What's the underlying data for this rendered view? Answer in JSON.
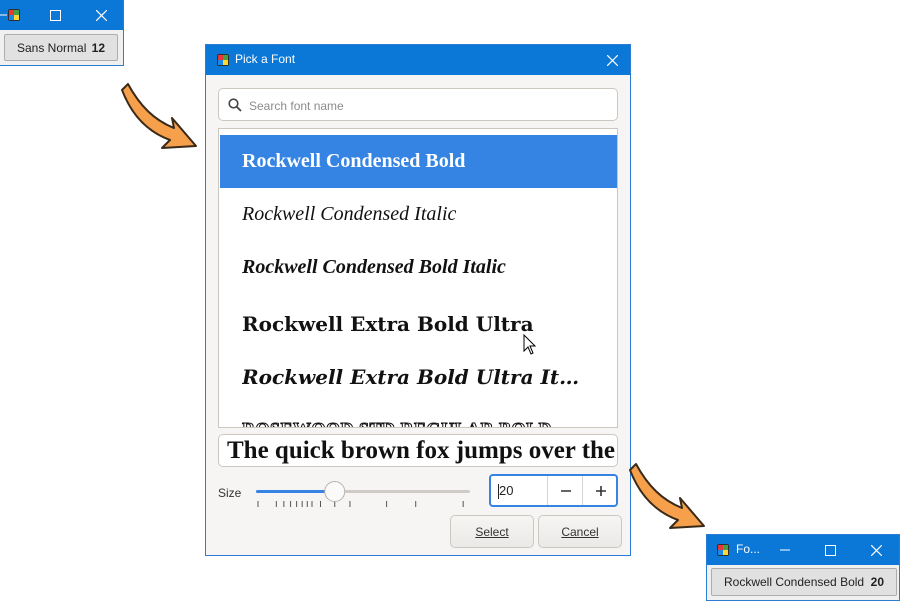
{
  "top_window": {
    "button": {
      "font_label": "Sans Normal",
      "size": "12"
    }
  },
  "dialog": {
    "title": "Pick a Font",
    "search": {
      "placeholder": "Search font name",
      "value": ""
    },
    "font_list": [
      {
        "label": "Rockwell Condensed Bold",
        "selected": true
      },
      {
        "label": "Rockwell Condensed Italic",
        "selected": false
      },
      {
        "label": "Rockwell Condensed Bold Italic",
        "selected": false
      },
      {
        "label": "Rockwell Extra Bold Ultra",
        "selected": false
      },
      {
        "label": "Rockwell Extra Bold Ultra Italic",
        "selected": false
      },
      {
        "label": "ROSEWOOD STD REGULAR BOLD",
        "selected": false
      }
    ],
    "preview_text": "The quick brown fox jumps over the lazy dog",
    "size_label": "Size",
    "size_value": "20",
    "slider_level": 20,
    "buttons": {
      "select": "Select",
      "cancel": "Cancel"
    }
  },
  "result_window": {
    "title": "Fo...",
    "button": {
      "font_label": "Rockwell Condensed Bold",
      "size": "20"
    }
  },
  "colors": {
    "titlebar": "#0b78d7",
    "selection": "#3584e4",
    "arrow_fill": "#f7a04b",
    "arrow_outline": "#3a2a1a"
  },
  "icons": [
    "app-icon",
    "minimize-icon",
    "maximize-icon",
    "close-icon",
    "search-icon",
    "minus-icon",
    "plus-icon",
    "mouse-cursor-icon",
    "curved-arrow-icon"
  ]
}
